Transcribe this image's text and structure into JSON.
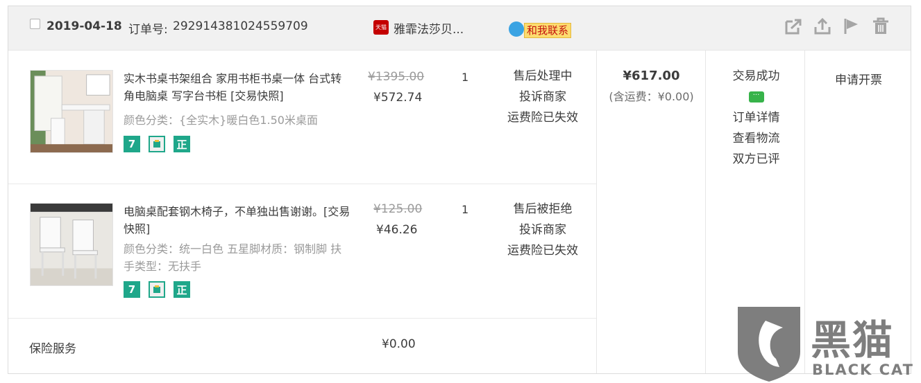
{
  "header": {
    "date": "2019-04-18",
    "order_label": "订单号:",
    "order_no": "292914381024559709",
    "shop_icon_text": "天猫",
    "shop_name": "雅霏法莎贝...",
    "contact_label": "和我联系"
  },
  "items": [
    {
      "title": "实木书桌书架组合 家用书柜书桌一体 台式转角电脑桌 写字台书柜 [交易快照]",
      "spec": "颜色分类：{全实木}暖白色1.50米桌面",
      "original_price": "¥1395.00",
      "price": "¥572.74",
      "qty": "1",
      "status": [
        "售后处理中",
        "投诉商家",
        "运费险已失效"
      ],
      "badges": [
        "7",
        "",
        "正"
      ]
    },
    {
      "title": "电脑桌配套钢木椅子，不单独出售谢谢。[交易快照]",
      "spec": "颜色分类：统一白色  五星脚材质：钢制脚  扶手类型：无扶手",
      "original_price": "¥125.00",
      "price": "¥46.26",
      "qty": "1",
      "status": [
        "售后被拒绝",
        "投诉商家",
        "运费险已失效"
      ],
      "badges": [
        "7",
        "",
        "正"
      ]
    }
  ],
  "total": {
    "amount": "¥617.00",
    "shipping": "(含运费：¥0.00)"
  },
  "trade": {
    "status": "交易成功",
    "detail": "订单详情",
    "logistics": "查看物流",
    "review": "双方已评"
  },
  "invoice": "申请开票",
  "insurance": {
    "label": "保险服务",
    "price": "¥0.00"
  },
  "watermark": {
    "cn": "黑猫",
    "en": "BLACK CAT"
  }
}
